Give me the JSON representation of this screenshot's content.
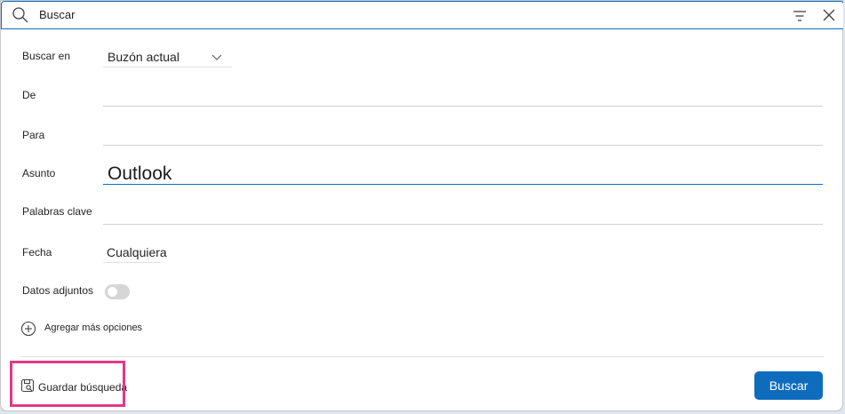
{
  "search": {
    "query": "Buscar"
  },
  "form": {
    "buscar_en": {
      "label": "Buscar en",
      "value": "Buzón actual"
    },
    "de": {
      "label": "De",
      "value": ""
    },
    "para": {
      "label": "Para",
      "value": ""
    },
    "asunto": {
      "label": "Asunto",
      "value": "Outlook"
    },
    "palabras_clave": {
      "label": "Palabras clave",
      "value": ""
    },
    "fecha": {
      "label": "Fecha",
      "value": "Cualquiera"
    },
    "datos_adjuntos": {
      "label": "Datos adjuntos",
      "toggle_on": false
    },
    "add_more_label": "Agregar más opciones"
  },
  "footer": {
    "save_search_label": "Guardar búsqueda",
    "search_button_label": "Buscar"
  },
  "colors": {
    "accent": "#0f6cbd",
    "highlight": "#e03a86"
  },
  "icons": [
    "search-icon",
    "filter-icon",
    "close-icon",
    "chevron-down-icon",
    "add-circle-icon",
    "save-icon"
  ]
}
